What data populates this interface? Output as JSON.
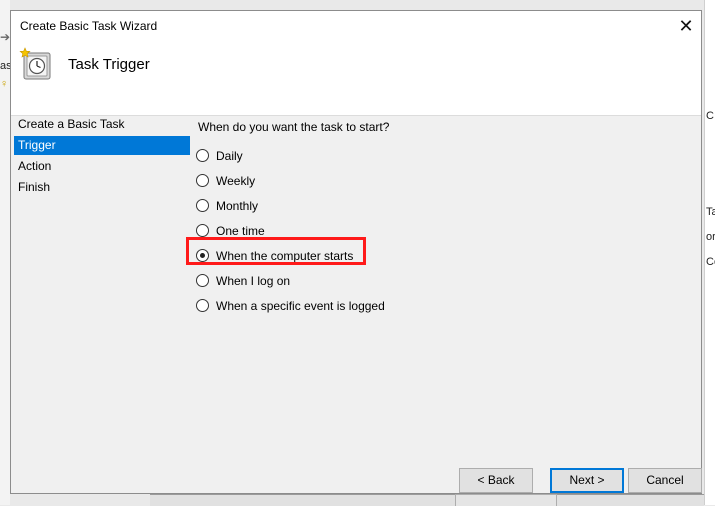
{
  "background": {
    "left_fragments": [
      "ası",
      "♀"
    ],
    "right_fragments": [
      "C.",
      "Ta",
      "ory",
      "Co"
    ]
  },
  "dialog": {
    "title": "Create Basic Task Wizard",
    "close_symbol": "✕",
    "header_title": "Task Trigger",
    "nav": [
      {
        "label": "Create a Basic Task",
        "selected": false
      },
      {
        "label": "Trigger",
        "selected": true
      },
      {
        "label": "Action",
        "selected": false
      },
      {
        "label": "Finish",
        "selected": false
      }
    ],
    "prompt": "When do you want the task to start?",
    "options": [
      {
        "label": "Daily",
        "checked": false
      },
      {
        "label": "Weekly",
        "checked": false
      },
      {
        "label": "Monthly",
        "checked": false
      },
      {
        "label": "One time",
        "checked": false
      },
      {
        "label": "When the computer starts",
        "checked": true
      },
      {
        "label": "When I log on",
        "checked": false
      },
      {
        "label": "When a specific event is logged",
        "checked": false
      }
    ],
    "buttons": {
      "back": "< Back",
      "next": "Next >",
      "cancel": "Cancel"
    }
  },
  "colors": {
    "selection": "#0078d7",
    "highlight": "#ff1a1a"
  }
}
